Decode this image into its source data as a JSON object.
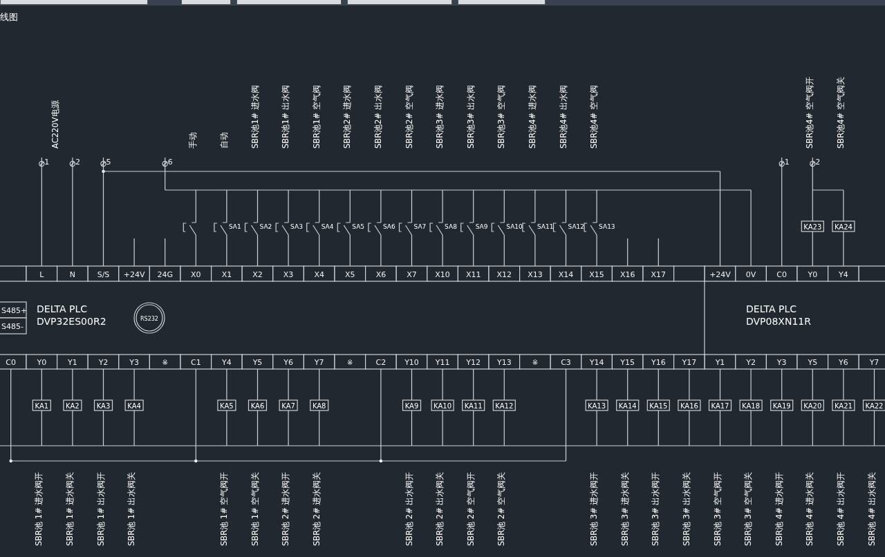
{
  "title": "线图",
  "power_label": "AC220V电源",
  "top_row": [
    {
      "kind": "blank"
    },
    {
      "kind": "power",
      "label": "L",
      "terminal": "1"
    },
    {
      "kind": "power",
      "label": "N",
      "terminal": "2"
    },
    {
      "kind": "power",
      "label": "S/S",
      "terminal": "5"
    },
    {
      "kind": "power",
      "label": "+24V",
      "stub": true
    },
    {
      "kind": "power",
      "label": "24G",
      "terminal": "6",
      "stub": true
    },
    {
      "label": "X0",
      "note": "手动",
      "switch": true
    },
    {
      "label": "X1",
      "note": "自动",
      "switch": true,
      "switch_label": "SA1"
    },
    {
      "label": "X2",
      "note": "SBR池1# 进水阀",
      "switch": true,
      "switch_label": "SA2"
    },
    {
      "label": "X3",
      "note": "SBR池1# 出水阀",
      "switch": true,
      "switch_label": "SA3"
    },
    {
      "label": "X4",
      "note": "SBR池1# 空气阀",
      "switch": true,
      "switch_label": "SA4"
    },
    {
      "label": "X5",
      "note": "SBR池2# 进水阀",
      "switch": true,
      "switch_label": "SA5"
    },
    {
      "label": "X6",
      "note": "SBR池2# 出水阀",
      "switch": true,
      "switch_label": "SA6"
    },
    {
      "label": "X7",
      "note": "SBR池2# 空气阀",
      "switch": true,
      "switch_label": "SA7"
    },
    {
      "label": "X10",
      "note": "SBR池3# 进水阀",
      "switch": true,
      "switch_label": "SA8"
    },
    {
      "label": "X11",
      "note": "SBR池3# 出水阀",
      "switch": true,
      "switch_label": "SA9"
    },
    {
      "label": "X12",
      "note": "SBR池3# 空气阀",
      "switch": true,
      "switch_label": "SA10"
    },
    {
      "label": "X13",
      "note": "SBR池4# 进水阀",
      "switch": true,
      "switch_label": "SA11"
    },
    {
      "label": "X14",
      "note": "SBR池4# 出水阀",
      "switch": true,
      "switch_label": "SA12"
    },
    {
      "label": "X15",
      "note": "SBR池4# 空气阀",
      "switch": true,
      "switch_label": "SA13"
    },
    {
      "label": "X16",
      "stub": true
    },
    {
      "label": "X17",
      "stub": true
    },
    {
      "kind": "blank"
    },
    {
      "kind": "power",
      "label": "+24V"
    },
    {
      "kind": "power",
      "label": "0V"
    },
    {
      "kind": "output",
      "label": "C0",
      "terminal": "1"
    },
    {
      "kind": "output",
      "label": "Y0",
      "terminal": "2",
      "relay": "KA23",
      "note": "SBR池4# 空气阀开"
    },
    {
      "kind": "output",
      "label": "Y4",
      "relay": "KA24",
      "note": "SBR池4# 空气阀关"
    },
    {
      "kind": "blank"
    }
  ],
  "modules": [
    {
      "ports": [
        "S485+",
        "S485-"
      ],
      "brand": "DELTA PLC",
      "model": "DVP32ES00R2",
      "connector": "RS232"
    },
    {
      "brand": "DELTA PLC",
      "model": "DVP08XN11R"
    }
  ],
  "bottom_row": [
    {
      "label": "C0",
      "kind": "common"
    },
    {
      "label": "Y0",
      "kind": "output",
      "relay": "KA1",
      "note": "SBR池 1# 进水阀开"
    },
    {
      "label": "Y1",
      "kind": "output",
      "relay": "KA2",
      "note": "SBR池 1# 进水阀关"
    },
    {
      "label": "Y2",
      "kind": "output",
      "relay": "KA3",
      "note": "SBR池 1# 出水阀开"
    },
    {
      "label": "Y3",
      "kind": "output",
      "relay": "KA4",
      "note": "SBR池 1# 出水阀关"
    },
    {
      "label": "※",
      "kind": "blank"
    },
    {
      "label": "C1",
      "kind": "common"
    },
    {
      "label": "Y4",
      "kind": "output",
      "relay": "KA5",
      "note": "SBR池 1# 空气阀开"
    },
    {
      "label": "Y5",
      "kind": "output",
      "relay": "KA6",
      "note": "SBR池 1# 空气阀关"
    },
    {
      "label": "Y6",
      "kind": "output",
      "relay": "KA7",
      "note": "SBR池 2# 进水阀开"
    },
    {
      "label": "Y7",
      "kind": "output",
      "relay": "KA8",
      "note": "SBR池 2# 进水阀关"
    },
    {
      "label": "※",
      "kind": "blank"
    },
    {
      "label": "C2",
      "kind": "common"
    },
    {
      "label": "Y10",
      "kind": "output",
      "relay": "KA9",
      "note": "SBR池 2# 出水阀开"
    },
    {
      "label": "Y11",
      "kind": "output",
      "relay": "KA10",
      "note": "SBR池 2# 出水阀关"
    },
    {
      "label": "Y12",
      "kind": "output",
      "relay": "KA11",
      "note": "SBR池 2# 空气阀开"
    },
    {
      "label": "Y13",
      "kind": "output",
      "relay": "KA12",
      "note": "SBR池 2# 空气阀关"
    },
    {
      "label": "※",
      "kind": "blank"
    },
    {
      "label": "C3",
      "kind": "common"
    },
    {
      "label": "Y14",
      "kind": "output",
      "relay": "KA13",
      "note": "SBR池 3# 进水阀开"
    },
    {
      "label": "Y15",
      "kind": "output",
      "relay": "KA14",
      "note": "SBR池 3# 进水阀关"
    },
    {
      "label": "Y16",
      "kind": "output",
      "relay": "KA15",
      "note": "SBR池 3# 出水阀开"
    },
    {
      "label": "Y17",
      "kind": "output",
      "relay": "KA16",
      "note": "SBR池 3# 出水阀关"
    },
    {
      "label": "Y1",
      "kind": "output",
      "relay": "KA17",
      "note": "SBR池 3# 空气阀开"
    },
    {
      "label": "Y2",
      "kind": "output",
      "relay": "KA18",
      "note": "SBR池 3# 空气阀关"
    },
    {
      "label": "Y3",
      "kind": "output",
      "relay": "KA19",
      "note": "SBR池 4# 进水阀开"
    },
    {
      "label": "Y5",
      "kind": "output",
      "relay": "KA20",
      "note": "SBR池 4# 进水阀关"
    },
    {
      "label": "Y6",
      "kind": "output",
      "relay": "KA21",
      "note": "SBR池 4# 出水阀开"
    },
    {
      "label": "Y7",
      "kind": "output",
      "relay": "KA22",
      "note": "SBR池 4# 出水阀关"
    }
  ]
}
